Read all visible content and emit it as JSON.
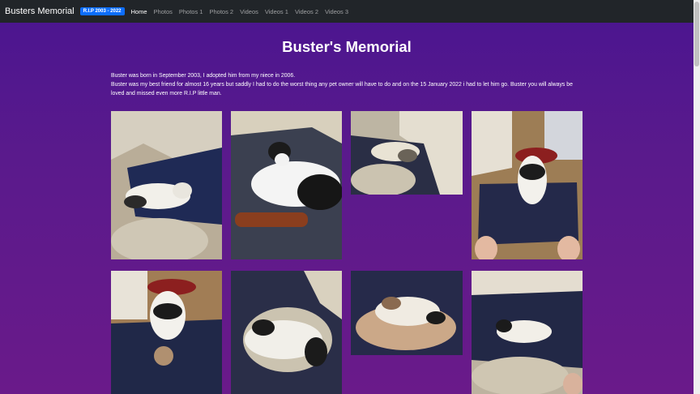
{
  "navbar": {
    "brand": "Busters Memorial",
    "badge": "R.I.P 2003 - 2022",
    "links": [
      "Home",
      "Photos",
      "Photos 1",
      "Photos 2",
      "Videos",
      "Videos 1",
      "Videos 2",
      "Videos 3"
    ]
  },
  "main": {
    "title": "Buster's Memorial",
    "paragraph1": "Buster was born in September 2003, I adopted him from my niece in 2006.",
    "paragraph2": "Buster was my best friend for almost 16 years but saddly I had to do the worst thing any pet owner will have to do and on the 15 January 2022 i had to let him go. Buster you will always be loved and missed even more R.I.P little man."
  },
  "colors": {
    "navbar": "#212529",
    "badge": "#0d6efd",
    "background_top": "#4a1590",
    "background_bottom": "#6a1a8a"
  }
}
